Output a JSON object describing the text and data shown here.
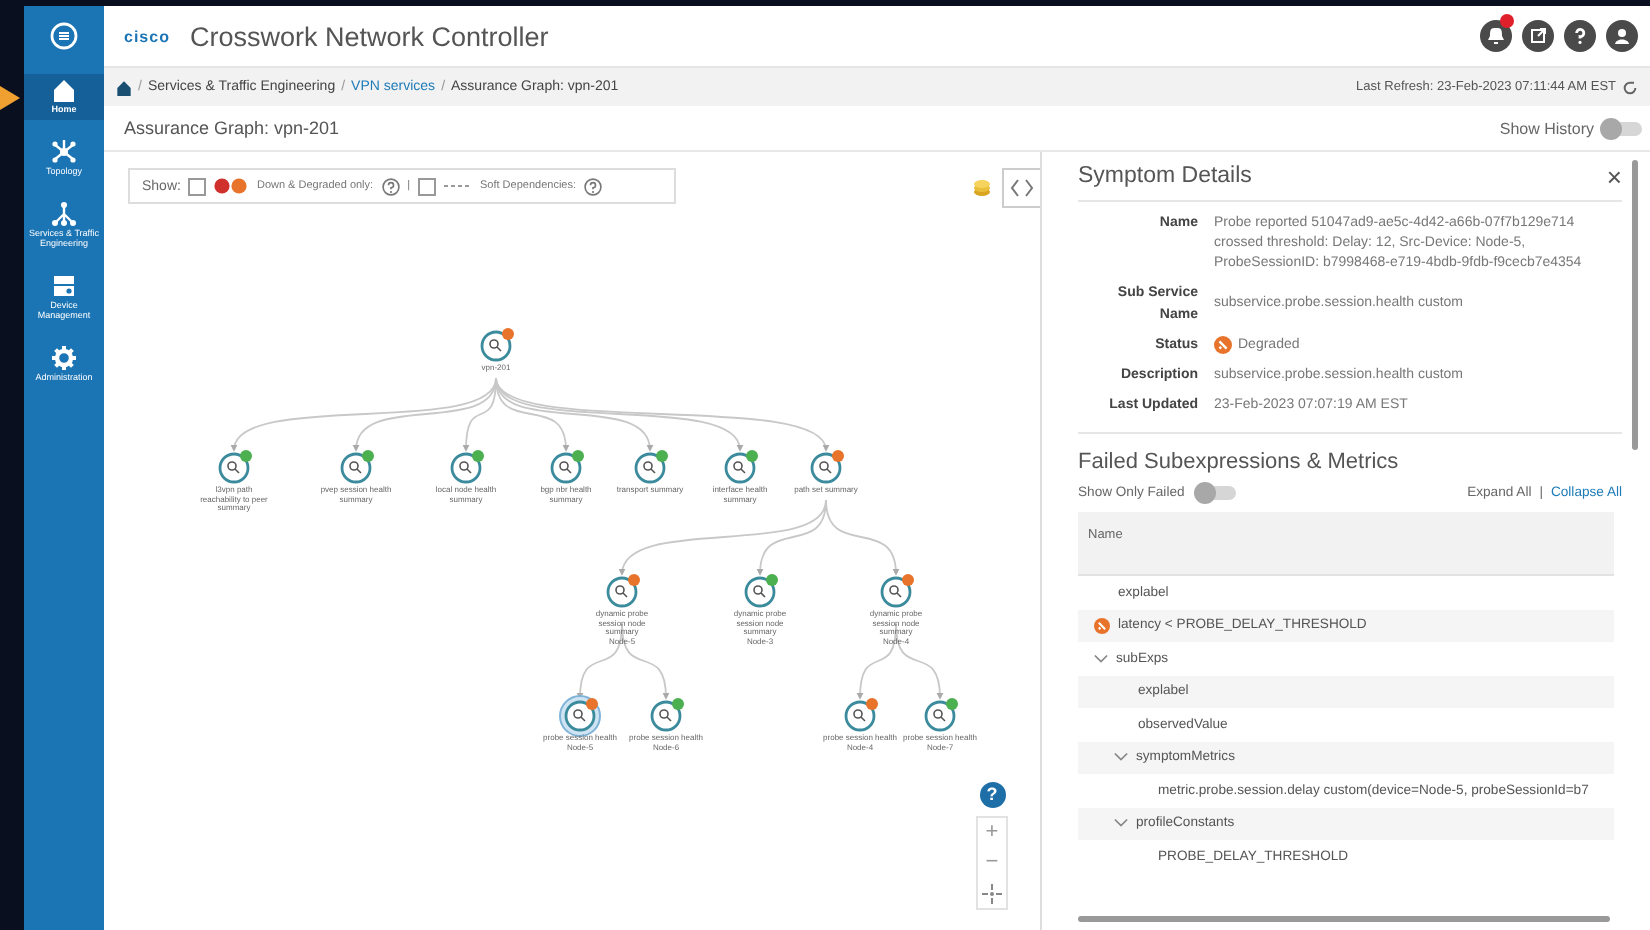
{
  "app": {
    "title": "Crosswork Network Controller",
    "logo": "cisco"
  },
  "sidebar": {
    "items": [
      {
        "label": "Home",
        "selected": true
      },
      {
        "label": "Topology",
        "selected": false
      },
      {
        "label": "Services & Traffic Engineering",
        "selected": false
      },
      {
        "label": "Device Management",
        "selected": false
      },
      {
        "label": "Administration",
        "selected": false
      }
    ]
  },
  "header": {
    "notification": true
  },
  "breadcrumb": [
    {
      "separator": "/",
      "label": "Services & Traffic Engineering",
      "link": false
    },
    {
      "separator": "/",
      "label": "VPN services",
      "link": true
    },
    {
      "separator": "/",
      "label": "Assurance Graph: vpn-201",
      "link": false
    }
  ],
  "last_refresh": "Last Refresh: 23-Feb-2023 07:11:44 AM EST",
  "page_title": "Assurance Graph: vpn-201",
  "show_history": {
    "label": "Show History",
    "on": false
  },
  "filter": {
    "show_label": "Show:",
    "down_degraded_label": "Down & Degraded only:",
    "down_degraded_checked": false,
    "soft_label": "Soft Dependencies:",
    "soft_checked": false,
    "separator": "|"
  },
  "graph": {
    "nodes": [
      {
        "label": "vpn-201",
        "color": "#e8742b",
        "selected": false,
        "children": [
          {
            "label": "l3vpn path reachability to peer summary",
            "color": "#4caf50",
            "selected": false
          },
          {
            "label": "pvep session health summary",
            "color": "#4caf50",
            "selected": false
          },
          {
            "label": "local node health summary",
            "color": "#4caf50",
            "selected": false
          },
          {
            "label": "bgp nbr health summary",
            "color": "#4caf50",
            "selected": false
          },
          {
            "label": "transport summary",
            "color": "#4caf50",
            "selected": false
          },
          {
            "label": "interface health summary",
            "color": "#4caf50",
            "selected": false
          },
          {
            "label": "path set summary",
            "color": "#e8742b",
            "selected": false,
            "children": [
              {
                "label": "dynamic probe session node summary",
                "sublabel": "Node-5",
                "color": "#e8742b",
                "selected": false,
                "children": [
                  {
                    "label": "probe session health",
                    "sublabel": "Node-5",
                    "color": "#e8742b",
                    "selected": true
                  },
                  {
                    "label": "probe session health",
                    "sublabel": "Node-6",
                    "color": "#4caf50",
                    "selected": false
                  }
                ]
              },
              {
                "label": "dynamic probe session node summary",
                "sublabel": "Node-3",
                "color": "#4caf50",
                "selected": false
              },
              {
                "label": "dynamic probe session node summary",
                "sublabel": "Node-4",
                "color": "#e8742b",
                "selected": false,
                "children": [
                  {
                    "label": "probe session health",
                    "sublabel": "Node-4",
                    "color": "#e8742b",
                    "selected": false
                  },
                  {
                    "label": "probe session health",
                    "sublabel": "Node-7",
                    "color": "#4caf50",
                    "selected": false
                  }
                ]
              }
            ]
          }
        ]
      }
    ]
  },
  "symptom": {
    "title": "Symptom Details",
    "close": "×",
    "details": [
      {
        "label": "Name",
        "value": "Probe reported 51047ad9-ae5c-4d42-a66b-07f7b129e714 crossed threshold: Delay: 12, Src-Device: Node-5, ProbeSessionID: b7998468-e719-4bdb-9fdb-f9cecb7e4354"
      },
      {
        "label": "Sub Service Name",
        "value": "subservice.probe.session.health custom"
      },
      {
        "label": "Status",
        "value": "Degraded",
        "color": "#e8742b"
      },
      {
        "label": "Description",
        "value": "subservice.probe.session.health custom"
      },
      {
        "label": "Last Updated",
        "value": "23-Feb-2023 07:07:19 AM EST"
      }
    ]
  },
  "failed": {
    "title": "Failed Subexpressions & Metrics",
    "toggle": {
      "label": "Show Only Failed",
      "on": false
    },
    "expand_all": "Expand All",
    "divider": "|",
    "collapse_all": "Collapse All",
    "column": "Name",
    "rows": [
      {
        "name": "explabel"
      },
      {
        "name": "latency < PROBE_DELAY_THRESHOLD",
        "color": "#e8742b"
      },
      {
        "name": "subExps",
        "expanded": true,
        "children": [
          {
            "name": "explabel"
          },
          {
            "name": "observedValue"
          },
          {
            "name": "symptomMetrics",
            "expanded": true,
            "children": [
              {
                "name": "metric.probe.session.delay custom(device=Node-5, probeSessionId=b7"
              }
            ]
          },
          {
            "name": "profileConstants",
            "expanded": true,
            "children": [
              {
                "name": "PROBE_DELAY_THRESHOLD"
              }
            ]
          }
        ]
      }
    ]
  },
  "zoom_controls": {
    "help": "?",
    "zoom_in": "+",
    "zoom_out": "−"
  }
}
